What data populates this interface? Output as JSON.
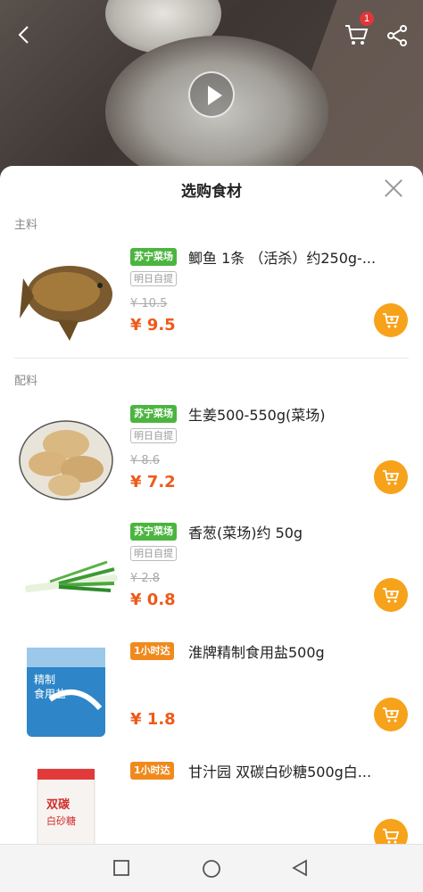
{
  "header": {
    "cart_badge": "1",
    "icons": [
      "back-arrow-icon",
      "cart-icon",
      "share-icon",
      "play-icon"
    ]
  },
  "sheet": {
    "title": "选购食材",
    "sections": {
      "main": "主料",
      "side": "配料"
    },
    "items": [
      {
        "tag": "苏宁菜场",
        "tag_color": "#4bb53f",
        "name": "鲫鱼 1条 （活杀）约250g-...",
        "pickup": "明日自提",
        "original_price": "¥ 10.5",
        "price": "¥ 9.5",
        "image": "carp-fish-image"
      },
      {
        "tag": "苏宁菜场",
        "tag_color": "#4bb53f",
        "name": "生姜500-550g(菜场)",
        "pickup": "明日自提",
        "original_price": "¥ 8.6",
        "price": "¥ 7.2",
        "image": "ginger-image"
      },
      {
        "tag": "苏宁菜场",
        "tag_color": "#4bb53f",
        "name": "香葱(菜场)约 50g",
        "pickup": "明日自提",
        "original_price": "¥ 2.8",
        "price": "¥ 0.8",
        "image": "scallion-image"
      },
      {
        "tag": "1小时达",
        "tag_color": "#f08a1d",
        "name": "淮牌精制食用盐500g",
        "price": "¥ 1.8",
        "image": "salt-package-image"
      },
      {
        "tag": "1小时达",
        "tag_color": "#f08a1d",
        "name": "甘汁园 双碳白砂糖500g白...",
        "image": "sugar-package-image"
      }
    ]
  },
  "salt_pack_text": "精制\n食用盐",
  "sugar_pack_text": "双碳\n白砂糖",
  "colors": {
    "price": "#ee5a19",
    "cart_button": "#f7a21b",
    "tag_green": "#4bb53f",
    "tag_orange": "#f08a1d"
  }
}
